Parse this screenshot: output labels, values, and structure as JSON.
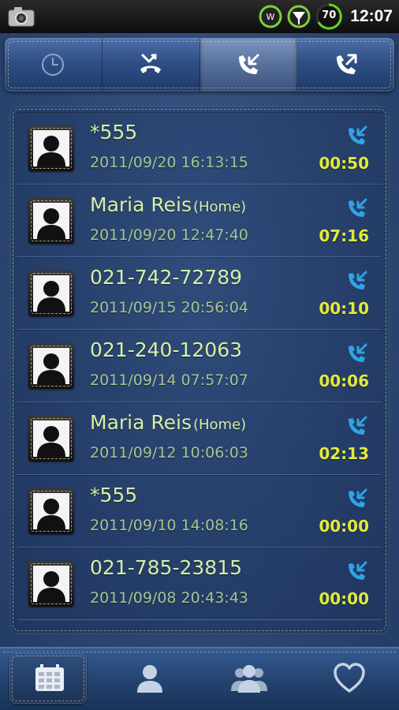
{
  "status_bar": {
    "time": "12:07",
    "battery": "70",
    "icons": [
      "camera-icon",
      "wifi-widget-icon",
      "signal-icon",
      "battery-icon"
    ]
  },
  "tabs": [
    {
      "name": "recent",
      "icon": "clock-icon"
    },
    {
      "name": "missed",
      "icon": "missed-call-icon"
    },
    {
      "name": "incoming",
      "icon": "incoming-call-icon",
      "active": true
    },
    {
      "name": "outgoing",
      "icon": "outgoing-call-icon"
    }
  ],
  "calls": [
    {
      "name": "*555",
      "label": "",
      "datetime": "2011/09/20 16:13:15",
      "duration": "00:50",
      "type": "incoming"
    },
    {
      "name": "Maria Reis",
      "label": "(Home)",
      "datetime": "2011/09/20 12:47:40",
      "duration": "07:16",
      "type": "incoming"
    },
    {
      "name": "021-742-72789",
      "label": "",
      "datetime": "2011/09/15 20:56:04",
      "duration": "00:10",
      "type": "incoming"
    },
    {
      "name": "021-240-12063",
      "label": "",
      "datetime": "2011/09/14 07:57:07",
      "duration": "00:06",
      "type": "incoming"
    },
    {
      "name": "Maria Reis",
      "label": "(Home)",
      "datetime": "2011/09/12 10:06:03",
      "duration": "02:13",
      "type": "incoming"
    },
    {
      "name": "*555",
      "label": "",
      "datetime": "2011/09/10 14:08:16",
      "duration": "00:00",
      "type": "incoming"
    },
    {
      "name": "021-785-23815",
      "label": "",
      "datetime": "2011/09/08 20:43:43",
      "duration": "00:00",
      "type": "incoming"
    }
  ],
  "bottom_nav": [
    {
      "name": "dialer",
      "icon": "dialpad-icon",
      "active": true
    },
    {
      "name": "contacts",
      "icon": "contact-icon"
    },
    {
      "name": "groups",
      "icon": "group-icon"
    },
    {
      "name": "favorites",
      "icon": "heart-icon"
    }
  ],
  "colors": {
    "name_text": "#d6f0a6",
    "datetime_text": "#a7c591",
    "duration_text": "#e2ea3a",
    "call_icon": "#2fa4e7",
    "background": "#2d4a7a"
  }
}
